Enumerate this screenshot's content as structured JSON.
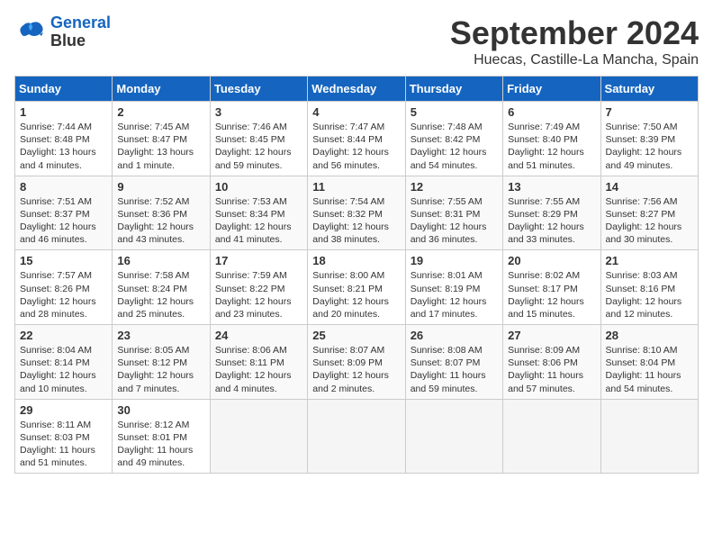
{
  "header": {
    "logo_line1": "General",
    "logo_line2": "Blue",
    "month": "September 2024",
    "location": "Huecas, Castille-La Mancha, Spain"
  },
  "weekdays": [
    "Sunday",
    "Monday",
    "Tuesday",
    "Wednesday",
    "Thursday",
    "Friday",
    "Saturday"
  ],
  "weeks": [
    [
      {
        "day": "1",
        "info": "Sunrise: 7:44 AM\nSunset: 8:48 PM\nDaylight: 13 hours\nand 4 minutes."
      },
      {
        "day": "2",
        "info": "Sunrise: 7:45 AM\nSunset: 8:47 PM\nDaylight: 13 hours\nand 1 minute."
      },
      {
        "day": "3",
        "info": "Sunrise: 7:46 AM\nSunset: 8:45 PM\nDaylight: 12 hours\nand 59 minutes."
      },
      {
        "day": "4",
        "info": "Sunrise: 7:47 AM\nSunset: 8:44 PM\nDaylight: 12 hours\nand 56 minutes."
      },
      {
        "day": "5",
        "info": "Sunrise: 7:48 AM\nSunset: 8:42 PM\nDaylight: 12 hours\nand 54 minutes."
      },
      {
        "day": "6",
        "info": "Sunrise: 7:49 AM\nSunset: 8:40 PM\nDaylight: 12 hours\nand 51 minutes."
      },
      {
        "day": "7",
        "info": "Sunrise: 7:50 AM\nSunset: 8:39 PM\nDaylight: 12 hours\nand 49 minutes."
      }
    ],
    [
      {
        "day": "8",
        "info": "Sunrise: 7:51 AM\nSunset: 8:37 PM\nDaylight: 12 hours\nand 46 minutes."
      },
      {
        "day": "9",
        "info": "Sunrise: 7:52 AM\nSunset: 8:36 PM\nDaylight: 12 hours\nand 43 minutes."
      },
      {
        "day": "10",
        "info": "Sunrise: 7:53 AM\nSunset: 8:34 PM\nDaylight: 12 hours\nand 41 minutes."
      },
      {
        "day": "11",
        "info": "Sunrise: 7:54 AM\nSunset: 8:32 PM\nDaylight: 12 hours\nand 38 minutes."
      },
      {
        "day": "12",
        "info": "Sunrise: 7:55 AM\nSunset: 8:31 PM\nDaylight: 12 hours\nand 36 minutes."
      },
      {
        "day": "13",
        "info": "Sunrise: 7:55 AM\nSunset: 8:29 PM\nDaylight: 12 hours\nand 33 minutes."
      },
      {
        "day": "14",
        "info": "Sunrise: 7:56 AM\nSunset: 8:27 PM\nDaylight: 12 hours\nand 30 minutes."
      }
    ],
    [
      {
        "day": "15",
        "info": "Sunrise: 7:57 AM\nSunset: 8:26 PM\nDaylight: 12 hours\nand 28 minutes."
      },
      {
        "day": "16",
        "info": "Sunrise: 7:58 AM\nSunset: 8:24 PM\nDaylight: 12 hours\nand 25 minutes."
      },
      {
        "day": "17",
        "info": "Sunrise: 7:59 AM\nSunset: 8:22 PM\nDaylight: 12 hours\nand 23 minutes."
      },
      {
        "day": "18",
        "info": "Sunrise: 8:00 AM\nSunset: 8:21 PM\nDaylight: 12 hours\nand 20 minutes."
      },
      {
        "day": "19",
        "info": "Sunrise: 8:01 AM\nSunset: 8:19 PM\nDaylight: 12 hours\nand 17 minutes."
      },
      {
        "day": "20",
        "info": "Sunrise: 8:02 AM\nSunset: 8:17 PM\nDaylight: 12 hours\nand 15 minutes."
      },
      {
        "day": "21",
        "info": "Sunrise: 8:03 AM\nSunset: 8:16 PM\nDaylight: 12 hours\nand 12 minutes."
      }
    ],
    [
      {
        "day": "22",
        "info": "Sunrise: 8:04 AM\nSunset: 8:14 PM\nDaylight: 12 hours\nand 10 minutes."
      },
      {
        "day": "23",
        "info": "Sunrise: 8:05 AM\nSunset: 8:12 PM\nDaylight: 12 hours\nand 7 minutes."
      },
      {
        "day": "24",
        "info": "Sunrise: 8:06 AM\nSunset: 8:11 PM\nDaylight: 12 hours\nand 4 minutes."
      },
      {
        "day": "25",
        "info": "Sunrise: 8:07 AM\nSunset: 8:09 PM\nDaylight: 12 hours\nand 2 minutes."
      },
      {
        "day": "26",
        "info": "Sunrise: 8:08 AM\nSunset: 8:07 PM\nDaylight: 11 hours\nand 59 minutes."
      },
      {
        "day": "27",
        "info": "Sunrise: 8:09 AM\nSunset: 8:06 PM\nDaylight: 11 hours\nand 57 minutes."
      },
      {
        "day": "28",
        "info": "Sunrise: 8:10 AM\nSunset: 8:04 PM\nDaylight: 11 hours\nand 54 minutes."
      }
    ],
    [
      {
        "day": "29",
        "info": "Sunrise: 8:11 AM\nSunset: 8:03 PM\nDaylight: 11 hours\nand 51 minutes."
      },
      {
        "day": "30",
        "info": "Sunrise: 8:12 AM\nSunset: 8:01 PM\nDaylight: 11 hours\nand 49 minutes."
      },
      {
        "day": "",
        "info": ""
      },
      {
        "day": "",
        "info": ""
      },
      {
        "day": "",
        "info": ""
      },
      {
        "day": "",
        "info": ""
      },
      {
        "day": "",
        "info": ""
      }
    ]
  ]
}
